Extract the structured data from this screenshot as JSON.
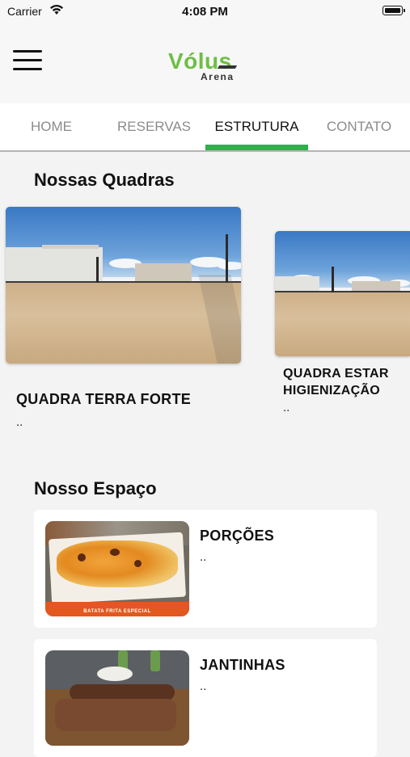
{
  "status_bar": {
    "carrier": "Carrier",
    "time": "4:08 PM"
  },
  "header": {
    "logo_main": "Vólus",
    "logo_sub": "Arena"
  },
  "tabs": [
    {
      "label": "HOME"
    },
    {
      "label": "RESERVAS"
    },
    {
      "label": "ESTRUTURA",
      "active": true
    },
    {
      "label": "CONTATO"
    }
  ],
  "courts": {
    "title": "Nossas Quadras",
    "items": [
      {
        "name": "QUADRA TERRA FORTE",
        "desc": ".."
      },
      {
        "name": "QUADRA ESTAR HIGIENIZAÇÃO",
        "desc": ".."
      }
    ]
  },
  "space": {
    "title": "Nosso Espaço",
    "items": [
      {
        "title": "PORÇÕES",
        "desc": "..",
        "thumb_caption": "BATATA FRITA ESPECIAL"
      },
      {
        "title": "JANTINHAS",
        "desc": ".."
      }
    ]
  },
  "colors": {
    "accent": "#2bb24c",
    "logo_green": "#6cbf43",
    "background": "#f3f3f3"
  },
  "icons": [
    "wifi-icon",
    "battery-icon",
    "menu-icon"
  ]
}
